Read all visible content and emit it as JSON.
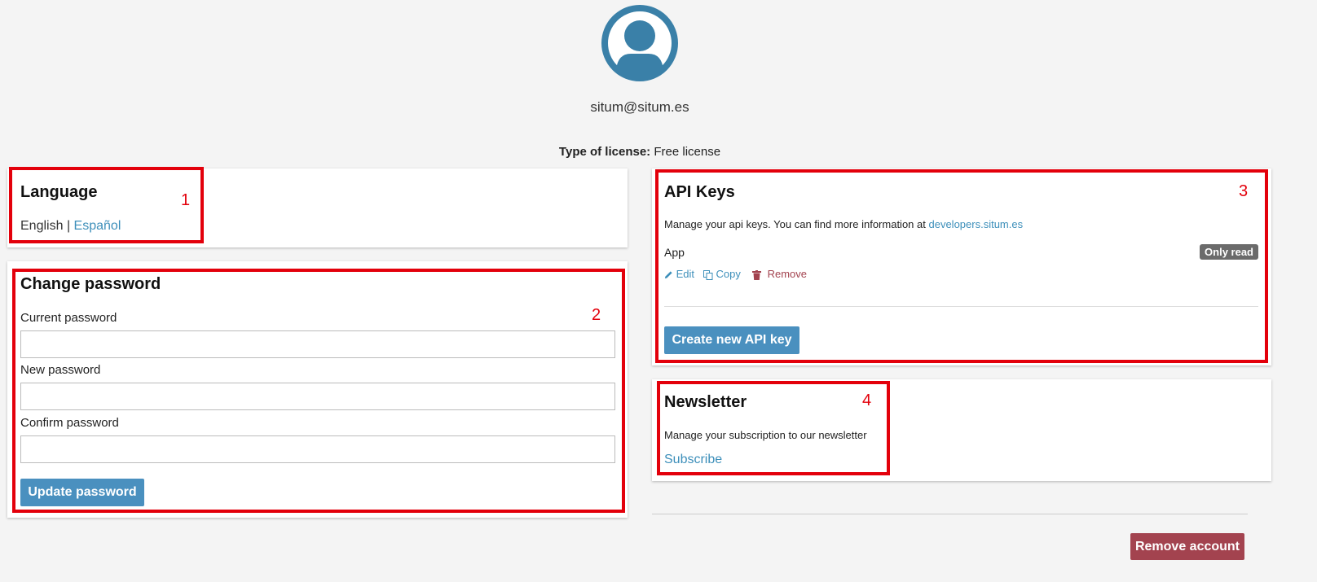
{
  "profile": {
    "email": "situm@situm.es",
    "license_label": "Type of license:",
    "license_value": "Free license"
  },
  "language": {
    "title": "Language",
    "english": "English",
    "separator": "|",
    "spanish": "Español"
  },
  "password": {
    "title": "Change password",
    "current_label": "Current password",
    "current_value": "",
    "new_label": "New password",
    "new_value": "",
    "confirm_label": "Confirm password",
    "confirm_value": "",
    "update_button": "Update password"
  },
  "api_keys": {
    "title": "API Keys",
    "description": "Manage your api keys. You can find more information at",
    "description_link": "developers.situm.es",
    "key_name": "App",
    "key_badge": "Only read",
    "edit_label": "Edit",
    "copy_label": "Copy",
    "remove_label": "Remove",
    "create_button": "Create new API key"
  },
  "newsletter": {
    "title": "Newsletter",
    "description": "Manage your subscription to our newsletter",
    "subscribe_link": "Subscribe"
  },
  "account": {
    "remove_button": "Remove account"
  },
  "annotations": [
    "1",
    "2",
    "3",
    "4"
  ],
  "colors": {
    "accent": "#4a90bf",
    "danger": "#a3434f",
    "annotation": "#e3000b",
    "avatar": "#3a80a8"
  }
}
